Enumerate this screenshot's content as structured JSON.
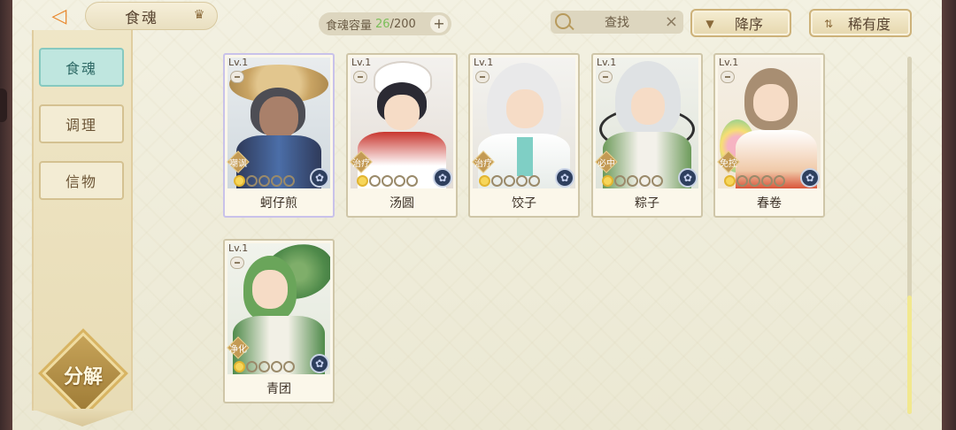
{
  "header": {
    "title": "食魂",
    "capacity_label": "食魂容量",
    "capacity_current": "26",
    "capacity_total": "/200",
    "plus_label": "+",
    "search_placeholder": "查找",
    "search_clear": "×",
    "sort_order_label": "降序",
    "sort_key_label": "稀有度"
  },
  "sidebar": {
    "tabs": [
      {
        "label": "食魂",
        "active": true
      },
      {
        "label": "调理",
        "active": false
      },
      {
        "label": "信物",
        "active": false
      }
    ],
    "decompose_label": "分解"
  },
  "cards": [
    {
      "level": "Lv.1",
      "role": "嘲讽",
      "name": "蚵仔煎",
      "stars_filled": 1,
      "stars_total": 5,
      "selected": true
    },
    {
      "level": "Lv.1",
      "role": "治疗",
      "name": "汤圆",
      "stars_filled": 1,
      "stars_total": 5,
      "selected": false
    },
    {
      "level": "Lv.1",
      "role": "治疗",
      "name": "饺子",
      "stars_filled": 1,
      "stars_total": 5,
      "selected": false
    },
    {
      "level": "Lv.1",
      "role": "必中",
      "name": "粽子",
      "stars_filled": 1,
      "stars_total": 5,
      "selected": false
    },
    {
      "level": "Lv.1",
      "role": "免控",
      "name": "春卷",
      "stars_filled": 1,
      "stars_total": 5,
      "selected": false
    },
    {
      "level": "Lv.1",
      "role": "净化",
      "name": "青团",
      "stars_filled": 1,
      "stars_total": 5,
      "selected": false
    }
  ],
  "colors": {
    "accent_teal": "#bfe6df",
    "gold": "#c39a54",
    "capacity_current": "#7bbf5a",
    "star_on": "#f7d65a"
  },
  "scroll_position": 0.67
}
